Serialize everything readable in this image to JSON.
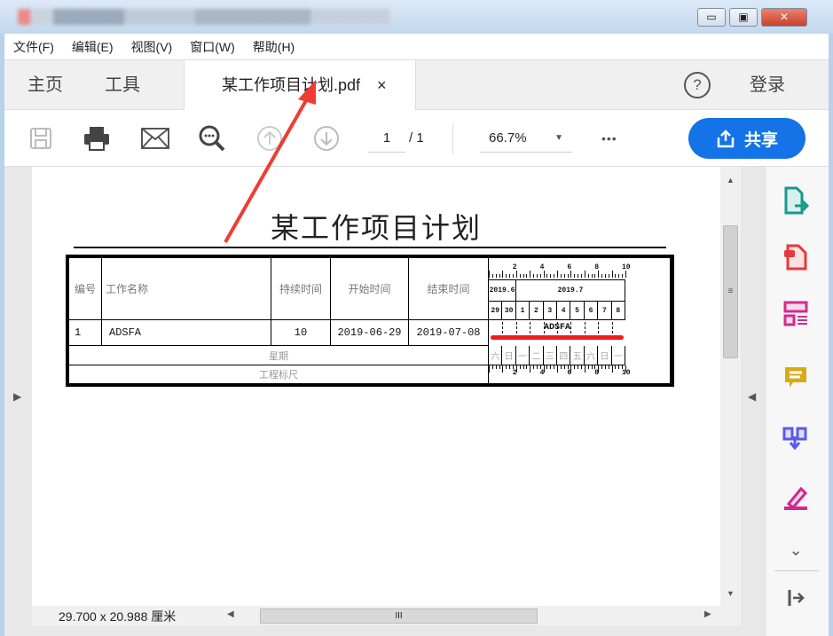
{
  "window": {
    "controls": {
      "minimize": "▭",
      "maximize": "▣",
      "close": "✕"
    }
  },
  "menu": [
    "文件(F)",
    "编辑(E)",
    "视图(V)",
    "窗口(W)",
    "帮助(H)"
  ],
  "tabs": {
    "home": "主页",
    "tools": "工具",
    "document": "某工作项目计划.pdf",
    "close": "×",
    "help": "?",
    "login": "登录"
  },
  "toolbar": {
    "page_current": "1",
    "page_total": "/ 1",
    "zoom": "66.7%",
    "more": "•••",
    "share": "共享"
  },
  "document": {
    "title": "某工作项目计划",
    "headers": [
      "编号",
      "工作名称",
      "持续时间",
      "开始时间",
      "结束时间"
    ],
    "row": {
      "id": "1",
      "name": "ADSFA",
      "duration": "10",
      "start": "2019-06-29",
      "end": "2019-07-08"
    },
    "gantt_bar_label": "ADSFA",
    "bar_color": "#ee1c1c",
    "ruler_labels": [
      "2",
      "4",
      "6",
      "8",
      "10"
    ],
    "months": [
      "2019.6",
      "2019.7"
    ],
    "days": [
      "29",
      "30",
      "1",
      "2",
      "3",
      "4",
      "5",
      "6",
      "7",
      "8"
    ],
    "weekday_label": "星期",
    "weekdays": [
      "六",
      "日",
      "一",
      "二",
      "三",
      "四",
      "五",
      "六",
      "日",
      "一"
    ],
    "ruler_row_label": "工程标尺"
  },
  "status": {
    "page_size": "29.700 x 20.988 厘米"
  }
}
